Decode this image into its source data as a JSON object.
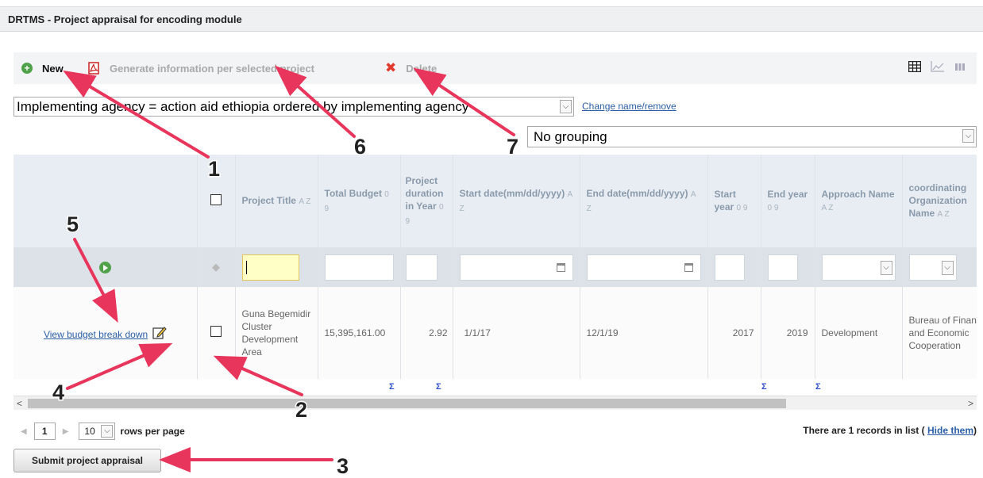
{
  "window": {
    "title": "DRTMS - Project appraisal for encoding module"
  },
  "toolbar": {
    "new_label": "New",
    "generate_label": "Generate information per selected project",
    "delete_label": "Delete",
    "icons": [
      "plus-circle-icon",
      "pdf-icon",
      "x-icon",
      "table-view-icon",
      "chart-view-icon",
      "column-view-icon"
    ]
  },
  "filter": {
    "selected": "Implementing agency = action aid ethiopia ordered by implementing agency",
    "change_link": "Change name/remove"
  },
  "grouping": {
    "selected": "No grouping"
  },
  "grid": {
    "columns": [
      {
        "label": "",
        "sort": ""
      },
      {
        "label": "",
        "sort": ""
      },
      {
        "label": "Project Title",
        "sort": "A Z"
      },
      {
        "label": "Total Budget",
        "sort": "0 9"
      },
      {
        "label": "Project duration in Year",
        "sort": "0 9"
      },
      {
        "label": "Start date(mm/dd/yyyy)",
        "sort": "A Z"
      },
      {
        "label": "End date(mm/dd/yyyy)",
        "sort": "A Z"
      },
      {
        "label": "Start year",
        "sort": "0 9"
      },
      {
        "label": "End year",
        "sort": "0 9"
      },
      {
        "label": "Approach Name",
        "sort": "A Z"
      },
      {
        "label": "coordinating Organization Name",
        "sort": "A Z"
      }
    ],
    "row": {
      "link": "View budget break down",
      "project_title": "Guna Begemidir Cluster Development Area",
      "total_budget": "15,395,161.00",
      "duration": "2.92",
      "start_date": "1/1/17",
      "end_date": "12/1/19",
      "start_year": "2017",
      "end_year": "2019",
      "approach": "Development",
      "coordinating_org": "Bureau of Finance and Economic Cooperation"
    },
    "sigma": "Σ"
  },
  "pager": {
    "page": "1",
    "rows_per_page": "10",
    "rows_label": "rows per page",
    "records_text": "There are 1 records in list (",
    "hide_link": "Hide them",
    "records_close": ")"
  },
  "submit_label": "Submit project appraisal",
  "annotations": {
    "color": "#e8355c",
    "labels": [
      "1",
      "2",
      "3",
      "4",
      "5",
      "6",
      "7"
    ]
  }
}
